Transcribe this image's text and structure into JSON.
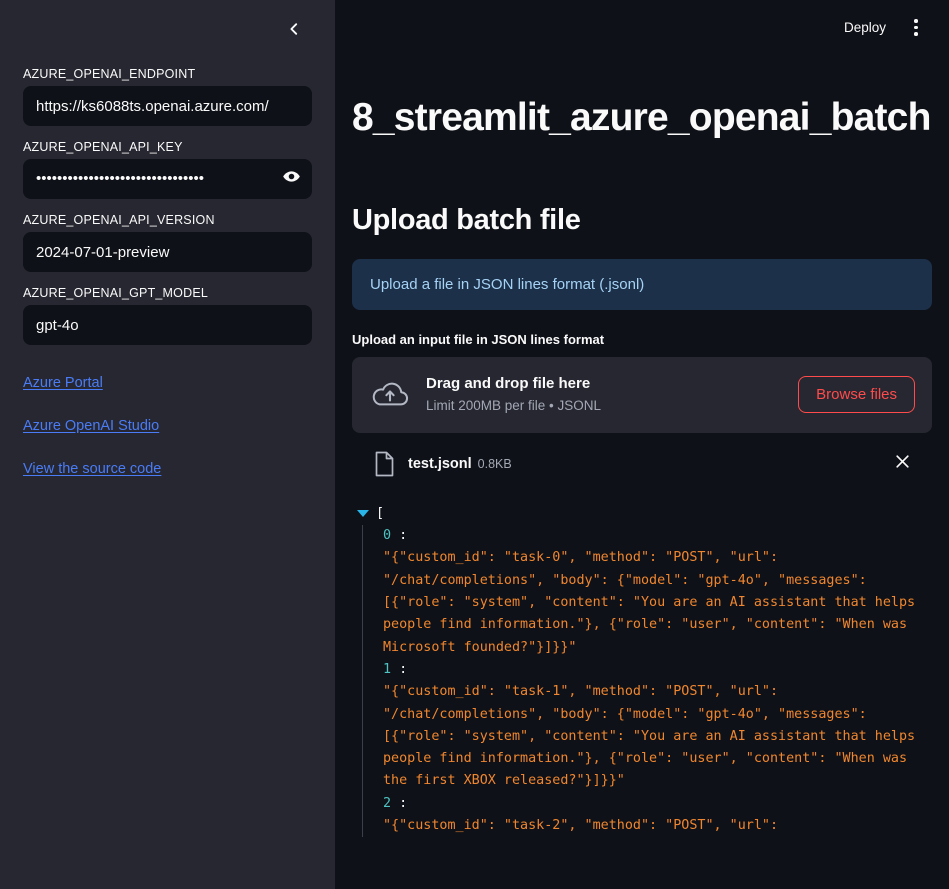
{
  "theme": {
    "sidebar_bg": "#262730",
    "main_bg": "#0e1117",
    "text": "#fafafa",
    "accent_red": "#ff4b4b",
    "link_blue": "#4a7cf7",
    "info_bg": "#1c3049",
    "info_text": "#a5d2f5",
    "json_string": "#f0862f",
    "json_key": "#4fc3c3",
    "tree_toggle": "#29b5e8"
  },
  "sidebar": {
    "collapse_icon": "chevron-left-icon",
    "fields": [
      {
        "label": "AZURE_OPENAI_ENDPOINT",
        "value": "https://ks6088ts.openai.azure.com/",
        "placeholder": "",
        "masked": false
      },
      {
        "label": "AZURE_OPENAI_API_KEY",
        "value": "••••••••••••••••••••••••••••••••",
        "placeholder": "",
        "masked": true,
        "reveal_icon": "eye-icon"
      },
      {
        "label": "AZURE_OPENAI_API_VERSION",
        "value": "2024-07-01-preview",
        "placeholder": "",
        "masked": false
      },
      {
        "label": "AZURE_OPENAI_GPT_MODEL",
        "value": "gpt-4o",
        "placeholder": "",
        "masked": false
      }
    ],
    "links": [
      {
        "label": "Azure Portal"
      },
      {
        "label": "Azure OpenAI Studio"
      },
      {
        "label": "View the source code"
      }
    ]
  },
  "header": {
    "deploy_label": "Deploy",
    "menu_icon": "kebab-menu-icon"
  },
  "main": {
    "page_title": "8_streamlit_azure_openai_batch",
    "section_title": "Upload batch file",
    "info_message": "Upload a file in JSON lines format (.jsonl)",
    "upload_caption": "Upload an input file in JSON lines format",
    "dropzone": {
      "icon": "cloud-upload-icon",
      "title": "Drag and drop file here",
      "subtitle": "Limit 200MB per file • JSONL",
      "browse_label": "Browse files"
    },
    "uploaded_file": {
      "icon": "file-icon",
      "name": "test.jsonl",
      "size": "0.8KB",
      "remove_icon": "close-icon"
    },
    "json_viewer": {
      "root_bracket": "[",
      "entries": [
        {
          "index": "0",
          "colon": ":",
          "value": "\"{\"custom_id\": \"task-0\", \"method\": \"POST\", \"url\": \"/chat/completions\", \"body\": {\"model\": \"gpt-4o\", \"messages\": [{\"role\": \"system\", \"content\": \"You are an AI assistant that helps people find information.\"}, {\"role\": \"user\", \"content\": \"When was Microsoft founded?\"}]}}\""
        },
        {
          "index": "1",
          "colon": ":",
          "value": "\"{\"custom_id\": \"task-1\", \"method\": \"POST\", \"url\": \"/chat/completions\", \"body\": {\"model\": \"gpt-4o\", \"messages\": [{\"role\": \"system\", \"content\": \"You are an AI assistant that helps people find information.\"}, {\"role\": \"user\", \"content\": \"When was the first XBOX released?\"}]}}\""
        },
        {
          "index": "2",
          "colon": ":",
          "value": "\"{\"custom_id\": \"task-2\", \"method\": \"POST\", \"url\":"
        }
      ]
    }
  }
}
